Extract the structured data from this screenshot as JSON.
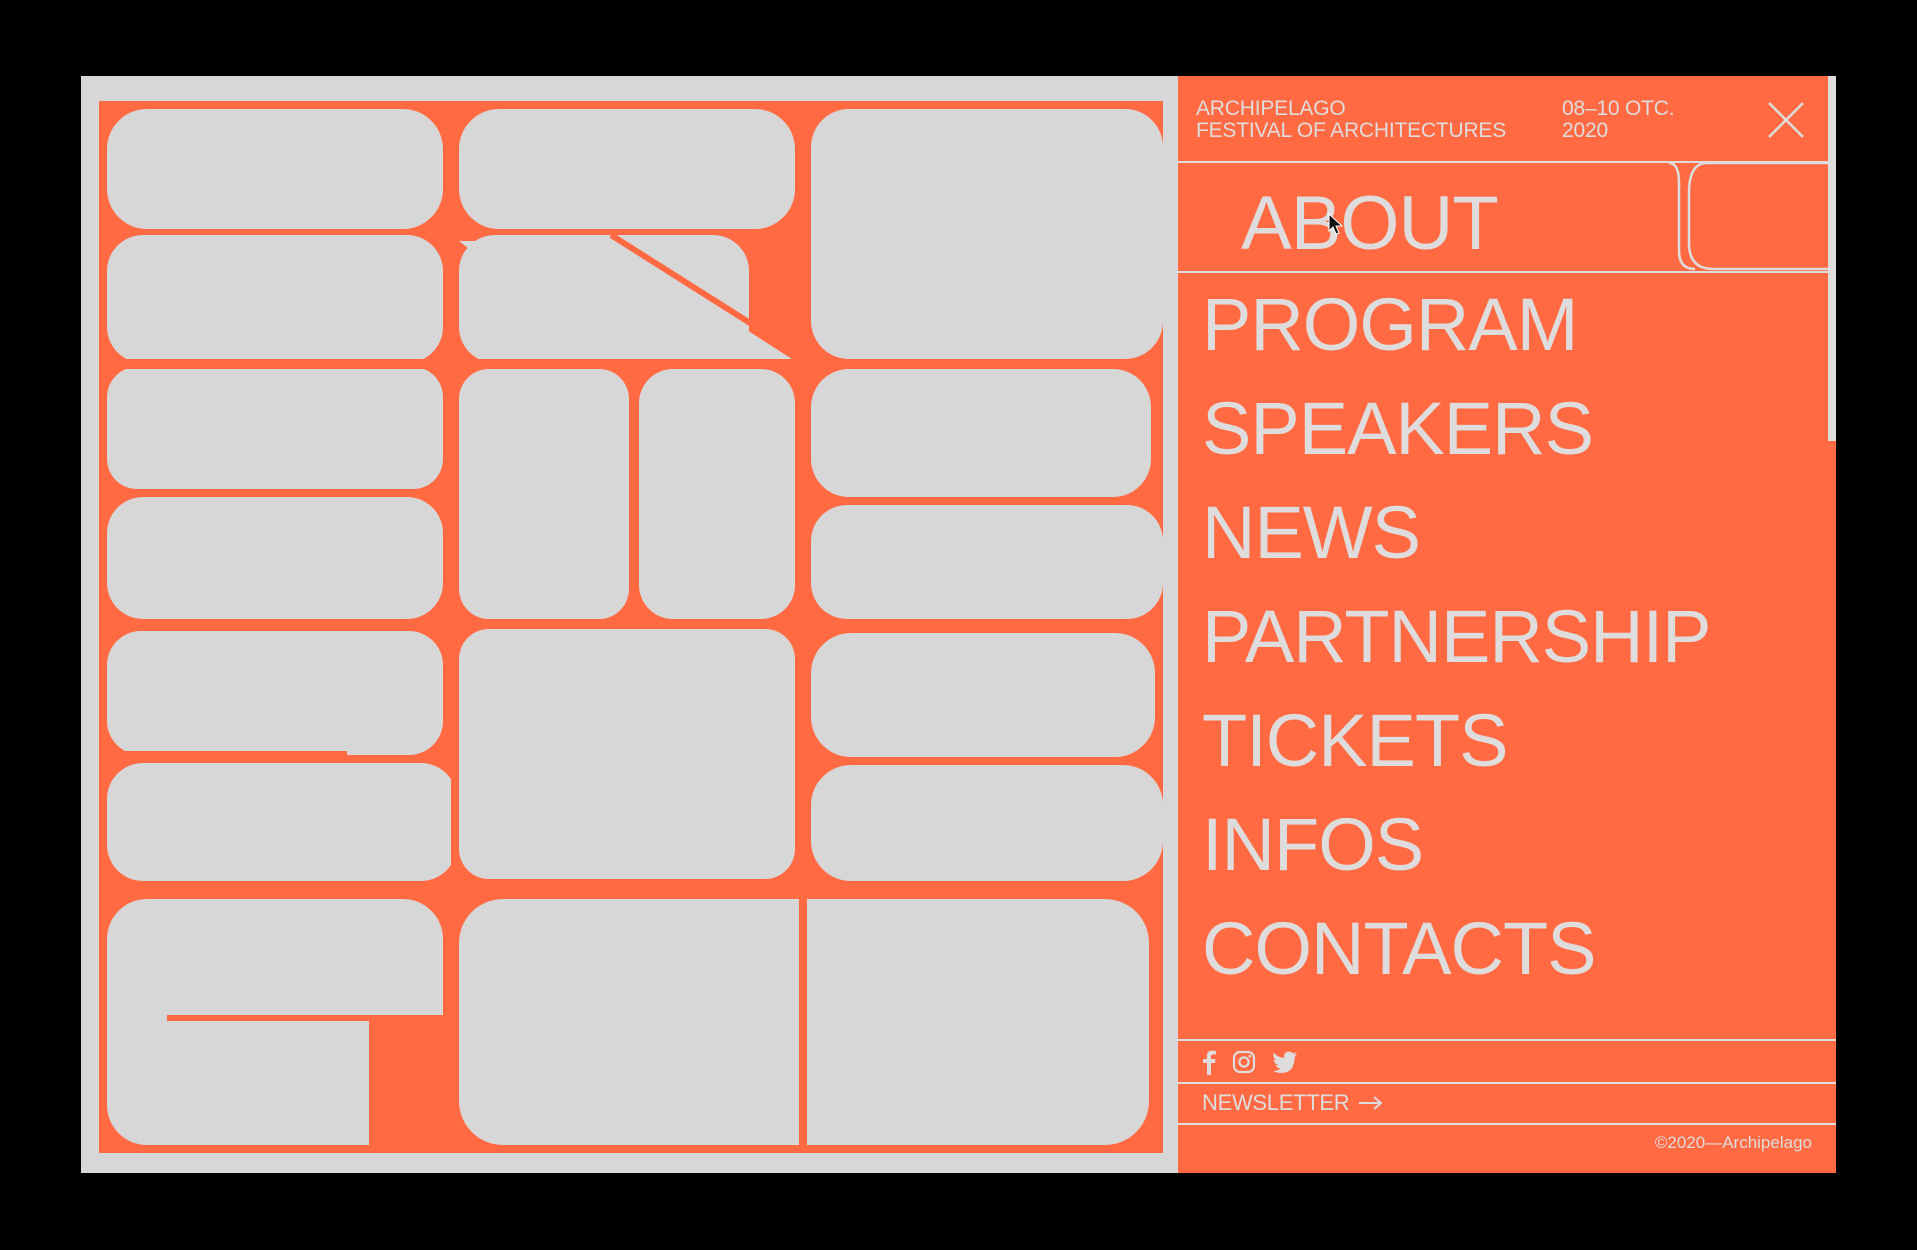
{
  "header": {
    "org_line1": "ARCHIPELAGO",
    "org_line2": "FESTIVAL OF ARCHITECTURES",
    "dates_line1": "08–10 OTC.",
    "dates_line2": "2020"
  },
  "menu": {
    "active": "ABOUT",
    "items": [
      "PROGRAM",
      "SPEAKERS",
      "NEWS",
      "PARTNERSHIP",
      "TICKETS",
      "INFOS",
      "CONTACTS"
    ]
  },
  "footer": {
    "newsletter": "NEWSLETTER",
    "copyright": "©2020—Archipelago"
  },
  "icons": [
    "close-icon",
    "facebook-icon",
    "instagram-icon",
    "twitter-icon",
    "arrow-right-icon"
  ],
  "colors": {
    "accent": "#ff6a42",
    "light": "#dedcdc",
    "background": "#000000",
    "canvas": "#d7d7d7"
  }
}
